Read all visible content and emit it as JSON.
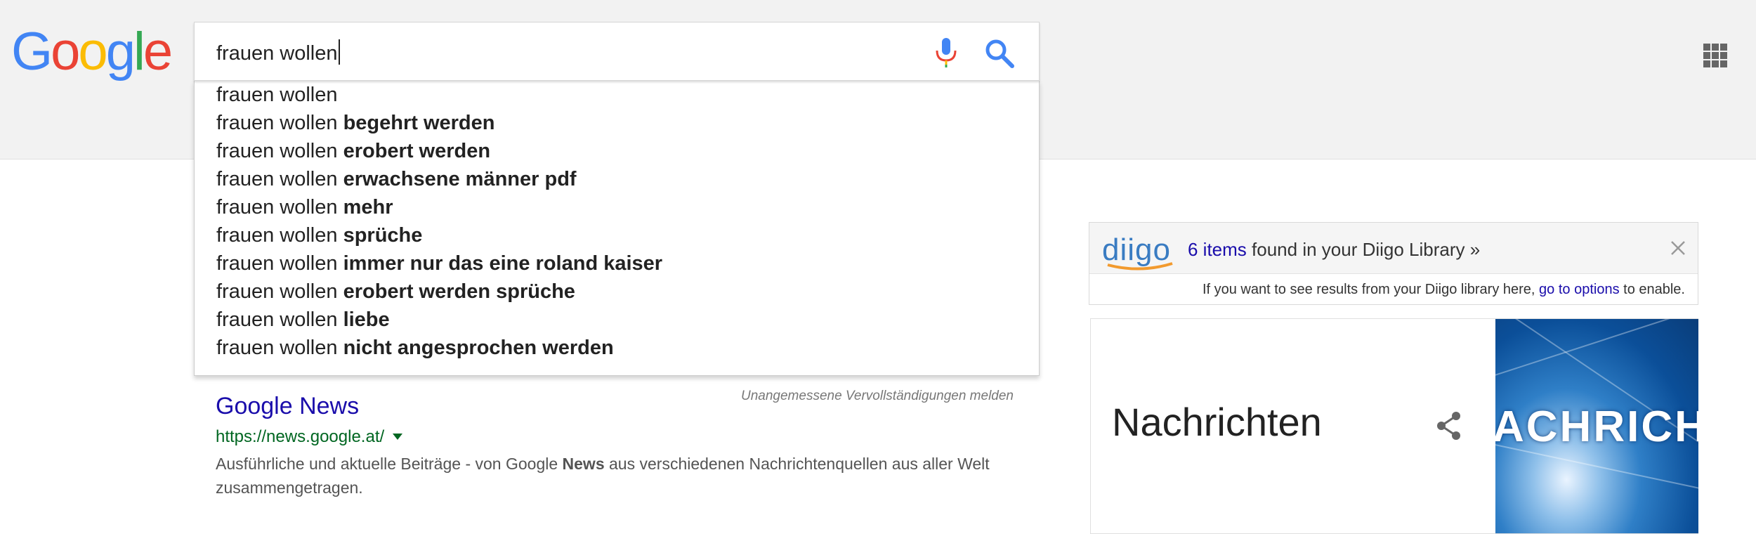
{
  "header": {
    "logo": [
      "G",
      "o",
      "o",
      "g",
      "l",
      "e"
    ],
    "logo_colors": [
      "#4285F4",
      "#EA4335",
      "#FBBC05",
      "#4285F4",
      "#34A853",
      "#EA4335"
    ],
    "apps_icon": "grid-icon"
  },
  "search": {
    "value": "frauen wollen",
    "mic_icon": "microphone-icon",
    "search_icon": "magnifier-icon",
    "accent": "#4285F4"
  },
  "suggestions": {
    "prefix": "frauen wollen",
    "items": [
      {
        "bold": ""
      },
      {
        "bold": "begehrt werden"
      },
      {
        "bold": "erobert werden"
      },
      {
        "bold": "erwachsene männer pdf"
      },
      {
        "bold": "mehr"
      },
      {
        "bold": "sprüche"
      },
      {
        "bold": "immer nur das eine roland kaiser"
      },
      {
        "bold": "erobert werden sprüche"
      },
      {
        "bold": "liebe"
      },
      {
        "bold": "nicht angesprochen werden"
      }
    ],
    "report": "Unangemessene Vervollständigungen melden"
  },
  "result": {
    "title": "Google News",
    "url": "https://news.google.at/",
    "snippet_1": "Ausführliche und aktuelle Beiträge - von Google ",
    "snippet_bold": "News",
    "snippet_2": " aus verschiedenen Nachrichtenquellen aus aller Welt zusammengetragen.",
    "title_color": "#1a0dab",
    "url_color": "#006621"
  },
  "diigo": {
    "logo": "diigo",
    "count_link": "6 items",
    "found_text": " found in your Diigo Library »",
    "info_1": "If you want to see results from your Diigo library here, ",
    "options_link": "go to options",
    "info_2": " to enable.",
    "close_icon": "close-icon"
  },
  "knowledge_panel": {
    "title": "Nachrichten",
    "share_icon": "share-icon",
    "image_text": "ACHRICHT"
  }
}
